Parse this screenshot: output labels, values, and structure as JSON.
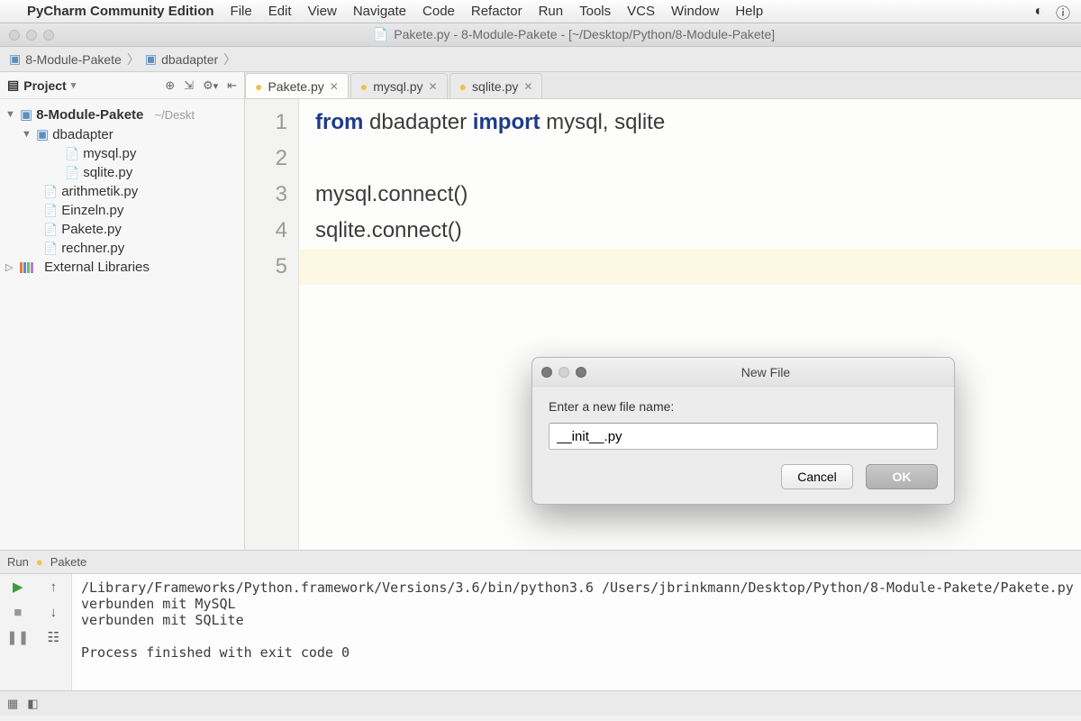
{
  "menubar": {
    "app_name": "PyCharm Community Edition",
    "items": [
      "File",
      "Edit",
      "View",
      "Navigate",
      "Code",
      "Refactor",
      "Run",
      "Tools",
      "VCS",
      "Window",
      "Help"
    ]
  },
  "titlebar": {
    "text": "Pakete.py - 8-Module-Pakete - [~/Desktop/Python/8-Module-Pakete]"
  },
  "breadcrumb": {
    "root": "8-Module-Pakete",
    "child": "dbadapter"
  },
  "sidebar": {
    "project_label": "Project",
    "tree": {
      "root": "8-Module-Pakete",
      "root_path": "~/Deskt",
      "folder": "dbadapter",
      "folder_children": [
        "mysql.py",
        "sqlite.py"
      ],
      "root_files": [
        "arithmetik.py",
        "Einzeln.py",
        "Pakete.py",
        "rechner.py"
      ],
      "external": "External Libraries"
    }
  },
  "tabs": [
    {
      "label": "Pakete.py",
      "active": true
    },
    {
      "label": "mysql.py",
      "active": false
    },
    {
      "label": "sqlite.py",
      "active": false
    }
  ],
  "code": {
    "lines": [
      {
        "n": "1",
        "html": "<span class='kw'>from</span> <span class='tok'>dbadapter</span> <span class='kw'>import</span> <span class='tok'>mysql, sqlite</span>"
      },
      {
        "n": "2",
        "html": ""
      },
      {
        "n": "3",
        "html": "<span class='tok'>mysql.connect()</span>"
      },
      {
        "n": "4",
        "html": "<span class='tok'>sqlite.connect()</span>"
      },
      {
        "n": "5",
        "html": ""
      }
    ],
    "current_line_index": 4
  },
  "run": {
    "tab_label": "Run",
    "config_name": "Pakete",
    "output": "/Library/Frameworks/Python.framework/Versions/3.6/bin/python3.6 /Users/jbrinkmann/Desktop/Python/8-Module-Pakete/Pakete.py\nverbunden mit MySQL\nverbunden mit SQLite\n\nProcess finished with exit code 0"
  },
  "dialog": {
    "title": "New File",
    "prompt": "Enter a new file name:",
    "value": "__init__.py",
    "cancel": "Cancel",
    "ok": "OK"
  }
}
